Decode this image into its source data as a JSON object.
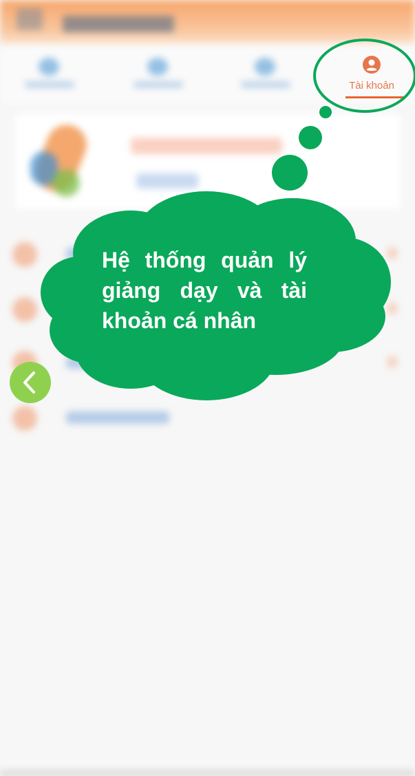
{
  "app": {
    "active_tab_label": "Tài khoản",
    "active_tab_icon": "account-circle-icon",
    "accent_color": "#e8652f"
  },
  "tutorial": {
    "cloud_text": "Hệ thống quản lý giảng dạy và tài khoản cá nhân",
    "cloud_color": "#0aa85a",
    "text_color": "#ffffff",
    "highlight_color": "#0aa85a"
  },
  "navigation": {
    "back_icon": "chevron-left-icon",
    "back_button_color": "#8fd14f"
  }
}
